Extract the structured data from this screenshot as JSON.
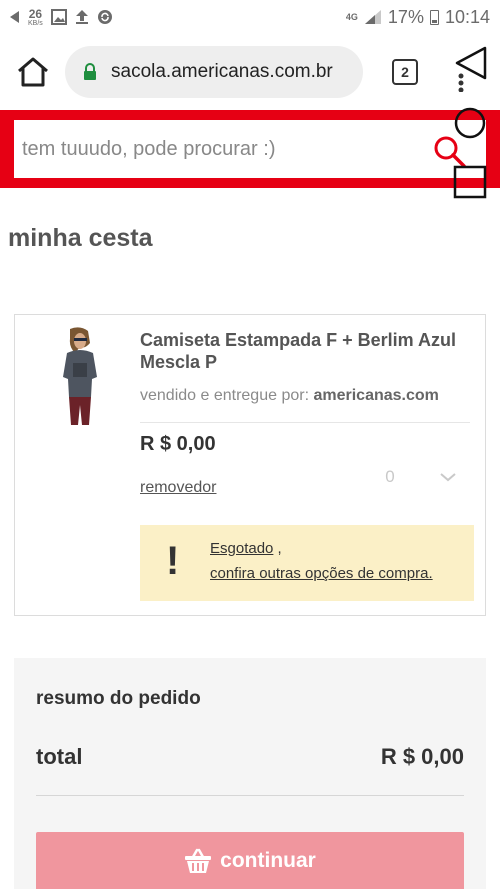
{
  "status_bar": {
    "speed_value": "26",
    "speed_unit": "KB/s",
    "network": "4G",
    "battery": "17%",
    "time": "10:14",
    "icons": [
      "back-arrow-icon",
      "image-icon",
      "upload-icon",
      "sync-icon",
      "signal-icon",
      "battery-icon"
    ]
  },
  "browser": {
    "url": "sacola.americanas.com.br",
    "tab_count": "2",
    "icons": [
      "home-icon",
      "lock-icon",
      "menu-icon"
    ]
  },
  "search": {
    "placeholder": "tem tuuudo, pode procurar :)",
    "icon": "search-icon",
    "band_color": "#e60014"
  },
  "cart": {
    "title": "minha cesta",
    "item": {
      "name": "Camiseta Estampada F + Berlim Azul Mescla P",
      "seller_prefix": "vendido e entregue por:",
      "seller_name": "americanas.com",
      "price": "R $ 0,00",
      "quantity": "0",
      "remove_label": "removedor",
      "warning": {
        "icon": "!",
        "status": "Esgotado",
        "status_suffix": " ,",
        "options_link": "confira outras opções de compra."
      }
    }
  },
  "summary": {
    "title": "resumo do pedido",
    "total_label": "total",
    "total_value": "R $ 0,00",
    "continue_label": "continuar",
    "continue_icon": "basket-icon",
    "button_color": "#f0969e"
  }
}
